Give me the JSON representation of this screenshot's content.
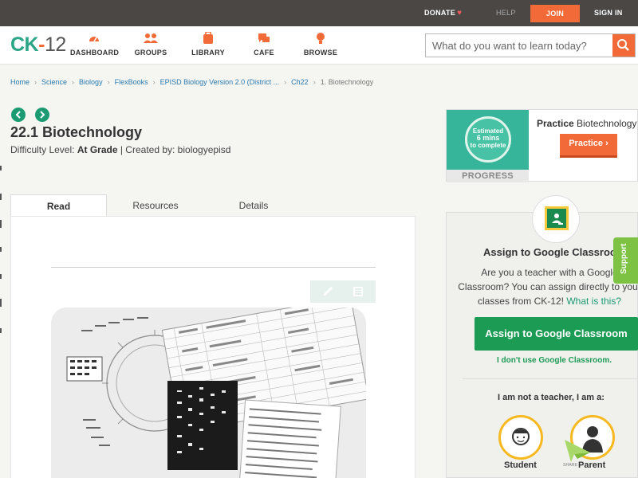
{
  "topbar": {
    "donate": "DONATE",
    "help": "HELP",
    "join": "JOIN",
    "signin": "SIGN IN"
  },
  "logo": {
    "ck": "CK",
    "dash": "-",
    "num": "12"
  },
  "nav": [
    {
      "label": "DASHBOARD",
      "icon": "dashboard-icon"
    },
    {
      "label": "GROUPS",
      "icon": "groups-icon"
    },
    {
      "label": "LIBRARY",
      "icon": "library-icon"
    },
    {
      "label": "CAFE",
      "icon": "cafe-icon"
    },
    {
      "label": "BROWSE",
      "icon": "browse-icon"
    }
  ],
  "search": {
    "placeholder": "What do you want to learn today?",
    "icon": "search-icon"
  },
  "breadcrumb": [
    "Home",
    "Science",
    "Biology",
    "FlexBooks",
    "EPISD Biology Version 2.0 (District ...",
    "Ch22",
    "1. Biotechnology"
  ],
  "lesson": {
    "title": "22.1 Biotechnology",
    "difficulty_label": "Difficulty Level:",
    "difficulty_value": "At Grade",
    "created_label": "| Created by: biologyepisd"
  },
  "tabs": [
    {
      "label": "Read",
      "active": true
    },
    {
      "label": "Resources",
      "active": false
    },
    {
      "label": "Details",
      "active": false
    }
  ],
  "practice": {
    "estimate_line1": "Estimated",
    "estimate_line2": "6 mins",
    "estimate_line3": "to complete",
    "progress": "PROGRESS",
    "title_bold": "Practice",
    "title_rest": "Biotechnology",
    "button": "Practice"
  },
  "assign": {
    "title": "Assign to Google Classroom",
    "desc": "Are you a teacher with a Google Classroom? You can assign directly to your classes from CK-12!",
    "whatis": "What is this?",
    "button": "Assign to Google Classroom",
    "no_link": "I don't use Google Classroom.",
    "teacher": "I am not a teacher, I am a:",
    "roles": [
      "Student",
      "Parent"
    ]
  },
  "support": "Support",
  "share": "SHARE",
  "colors": {
    "topbar": "#4a4745",
    "accent_orange": "#f26a37",
    "accent_green": "#1c9b55",
    "teal": "#36b59b"
  }
}
